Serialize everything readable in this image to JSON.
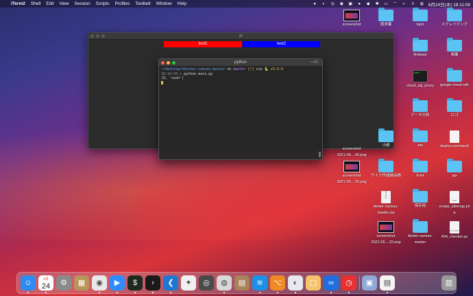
{
  "menubar": {
    "apple": "",
    "app": "iTerm2",
    "items": [
      "Shell",
      "Edit",
      "View",
      "Session",
      "Scripts",
      "Profiles",
      "Toolbelt",
      "Window",
      "Help"
    ],
    "datetime": "6月24日(木) 18:11:09"
  },
  "tk_window": {
    "title": "tk",
    "button1": "test1",
    "button2": "test2",
    "colors": {
      "button1": "#ff0000",
      "button2": "#0000ff"
    }
  },
  "terminal": {
    "title": "python",
    "shortcut": "⌥⌘1",
    "prompt_path": "~/desktop/tkinter-canvas-master",
    "prompt_on": "on",
    "branch_icon": "",
    "branch": "master",
    "status": "[!]",
    "via": "via",
    "python_icon": "🐍",
    "python_version": "v3.9.0",
    "time": "18:10:56",
    "arrow": ">",
    "command": "python main.py",
    "output": "(0, 'sash')"
  },
  "desktop_icons": [
    {
      "name": "screenshot-1",
      "label": "screenshot",
      "kind": "thumb"
    },
    {
      "name": "folder-request",
      "label": "請求書",
      "kind": "folder"
    },
    {
      "name": "folder-light",
      "label": "light",
      "kind": "folder"
    },
    {
      "name": "folder-scraping",
      "label": "スクレイピング",
      "kind": "folder"
    },
    {
      "name": "folder-firebase",
      "label": "firebase",
      "kind": "folder"
    },
    {
      "name": "folder-images",
      "label": "画像",
      "kind": "folder"
    },
    {
      "name": "file-cloud-sql-proxy",
      "label": "cloud_sql_proxy",
      "kind": "exec"
    },
    {
      "name": "folder-google-cloud-sdk",
      "label": "google-cloud-sdk",
      "kind": "folder"
    },
    {
      "name": "folder-data-analysis",
      "label": "データ分析",
      "kind": "folder"
    },
    {
      "name": "folder-logo",
      "label": "ロゴ",
      "kind": "folder"
    },
    {
      "name": "folder-novel",
      "label": "小説",
      "kind": "folder"
    },
    {
      "name": "folder-site",
      "label": "site",
      "kind": "folder"
    },
    {
      "name": "file-deploy-command",
      "label": "deploy.command",
      "kind": "doc"
    },
    {
      "name": "screenshot-2",
      "label": "screenshot\n2021-05....06.png",
      "kind": "none"
    },
    {
      "name": "folder-site-works",
      "label": "サイト作成納品物",
      "kind": "folder"
    },
    {
      "name": "folder-front",
      "label": "front",
      "kind": "folder"
    },
    {
      "name": "folder-api",
      "label": "api",
      "kind": "folder"
    },
    {
      "name": "screenshot-3",
      "label": "screenshot\n2021-05....26.png",
      "kind": "thumb"
    },
    {
      "name": "file-tkinter-zip",
      "label": "tkinter-canvas-\nmaster.zip",
      "kind": "zip"
    },
    {
      "name": "folder-archive",
      "label": "保存用",
      "kind": "folder"
    },
    {
      "name": "file-create-sitemap",
      "label": "create_sitemap.ph\np",
      "kind": "doc"
    },
    {
      "name": "screenshot-4",
      "label": "screenshot\n2021-05....22.png",
      "kind": "thumb"
    },
    {
      "name": "folder-tkinter-canvas-master",
      "label": "tkinter-canvas-\nmaster",
      "kind": "folder"
    },
    {
      "name": "file-404-checker",
      "label": "404_checker.py",
      "kind": "doc"
    }
  ],
  "doc_texts": {
    "php": "PHP",
    "py": "PYTHON"
  },
  "dock": {
    "calendar_month": "6月",
    "calendar_day": "24",
    "apps": [
      "finder",
      "calendar",
      "system-preferences",
      "amazon",
      "chrome",
      "zoom",
      "terminal-green",
      "iterm",
      "vscode",
      "safari",
      "quicktime",
      "sequel",
      "archive",
      "docker",
      "sourcetree",
      "preview",
      "notes",
      "dex",
      "clock",
      "photos",
      "document",
      "trash"
    ]
  }
}
